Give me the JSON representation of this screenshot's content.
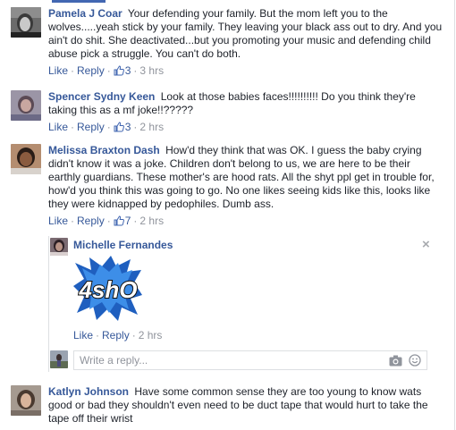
{
  "comments": [
    {
      "name": "Pamela J Coar",
      "text": "Your defending your family. But the mom left you to the wolves.....yeah stick by your family. They leaving your black ass out to dry. And you ain't do shit. She deactivated...but you promoting your music and defending child abuse pick a struggle. You can't do both.",
      "like": "Like",
      "reply": "Reply",
      "likes": "3",
      "time": "3 hrs"
    },
    {
      "name": "Spencer Sydny Keen",
      "text": "Look at those babies faces!!!!!!!!!! Do you think they're taking this as a mf joke!!?????",
      "like": "Like",
      "reply": "Reply",
      "likes": "3",
      "time": "2 hrs"
    },
    {
      "name": "Melissa Braxton Dash",
      "text": "How'd they think that was OK. I guess the baby crying didn't know it was a joke. Children don't belong to us, we are here to be their earthly guardians. These mother's are hood rats. All the shyt ppl get in trouble for, how'd you think this was going to go. No one likes seeing kids like this, looks like they were kidnapped by pedophiles. Dumb ass.",
      "like": "Like",
      "reply": "Reply",
      "likes": "7",
      "time": "2 hrs"
    },
    {
      "name": "Katlyn Johnson",
      "text": "Have some common sense they are too young to know wats good or bad they shouldn't even need to be duct tape that would hurt to take the tape off their wrist"
    }
  ],
  "reply": {
    "name": "Michelle Fernandes",
    "sticker_text": "4shO",
    "like": "Like",
    "reply": "Reply",
    "time": "2 hrs",
    "close": "×"
  },
  "reply_box": {
    "placeholder": "Write a reply..."
  },
  "icons": [
    "thumbs-up-icon",
    "close-icon",
    "camera-icon",
    "smiley-icon"
  ],
  "colors": {
    "link": "#365899",
    "meta": "#90949c",
    "border": "#dddfe2"
  }
}
